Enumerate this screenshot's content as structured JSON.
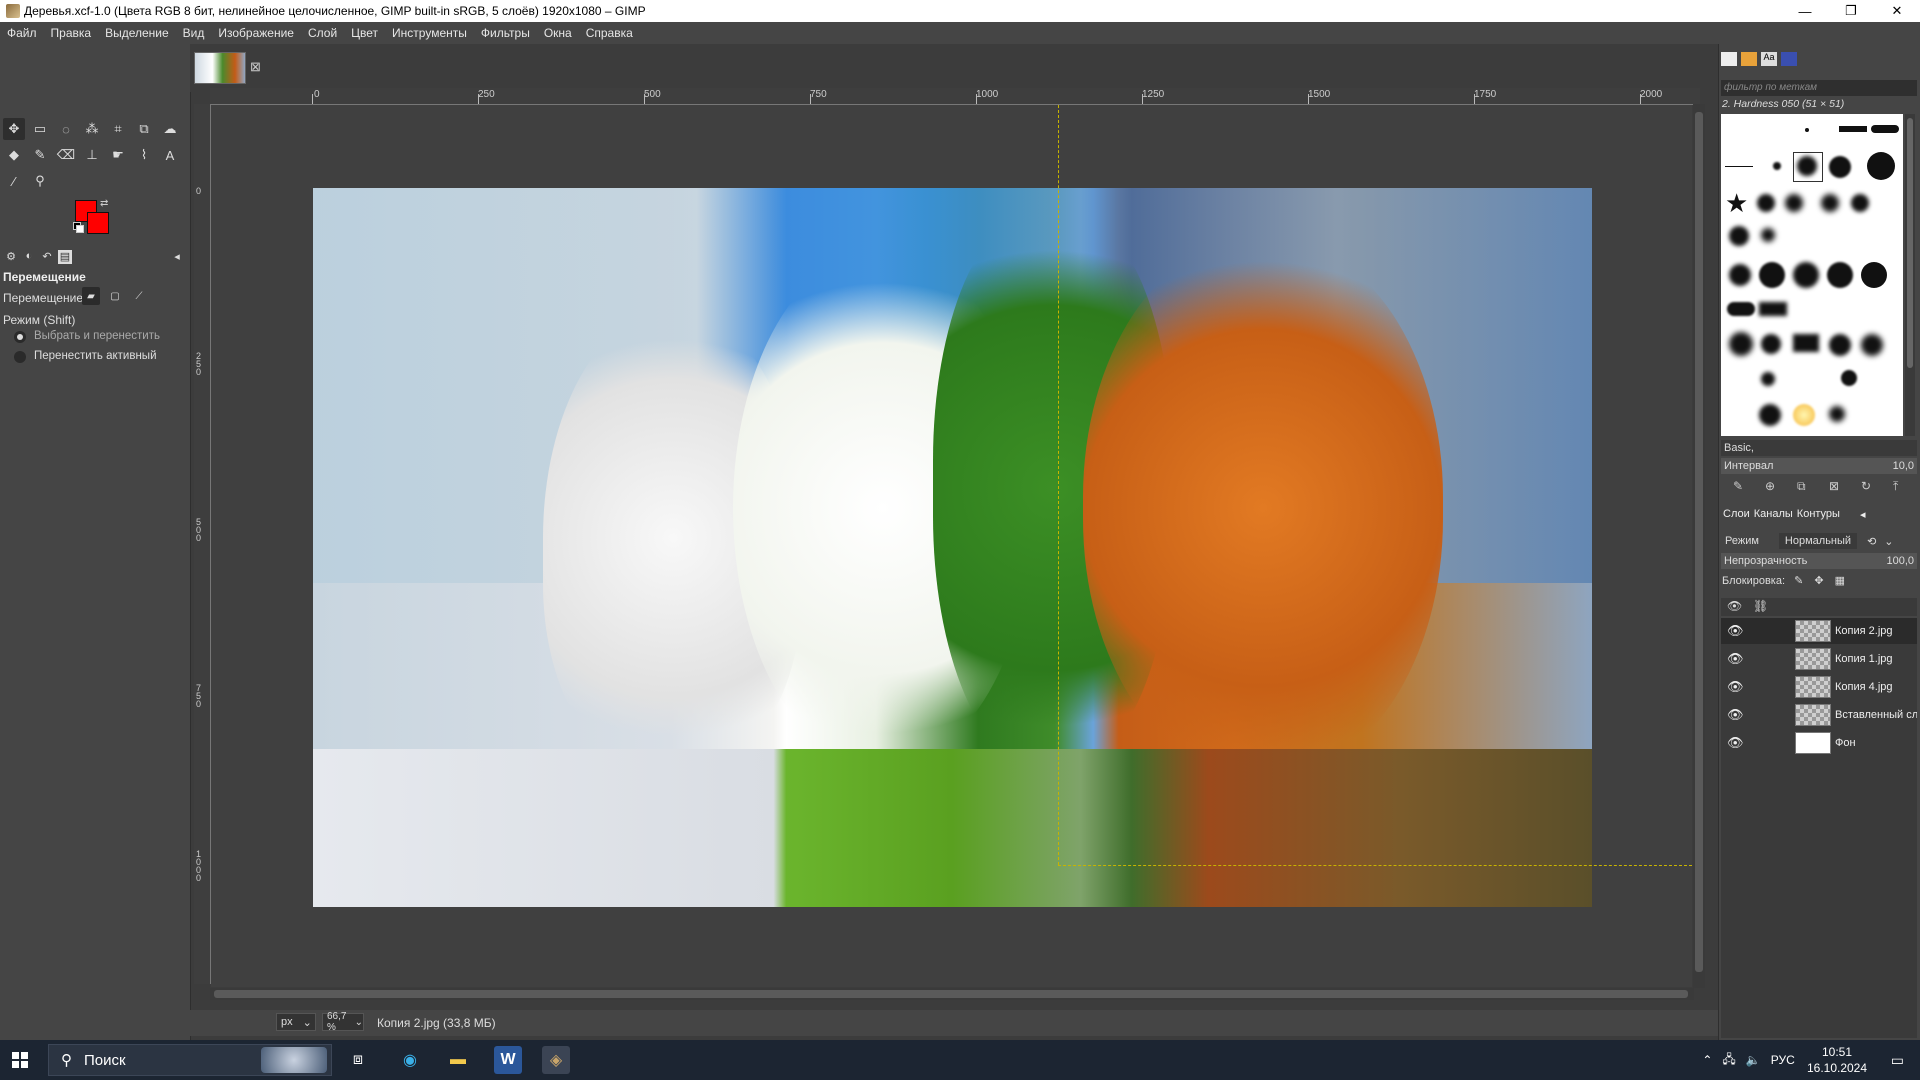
{
  "window": {
    "title": "Деревья.xcf-1.0 (Цвета RGB 8 бит, нелинейное целочисленное, GIMP built-in sRGB, 5 слоёв) 1920x1080 – GIMP",
    "minimize": "—",
    "maximize": "❐",
    "close": "✕"
  },
  "menu": [
    "Файл",
    "Правка",
    "Выделение",
    "Вид",
    "Изображение",
    "Слой",
    "Цвет",
    "Инструменты",
    "Фильтры",
    "Окна",
    "Справка"
  ],
  "tools": [
    "move-icon",
    "rect-select-icon",
    "lasso-icon",
    "fuzzy-select-icon",
    "crop-icon",
    "unified-transform-icon",
    "warp-icon",
    "bucket-fill-icon",
    "paintbrush-icon",
    "eraser-icon",
    "clone-icon",
    "smudge-icon",
    "path-icon",
    "text-icon",
    "color-picker-icon",
    "zoom-icon"
  ],
  "colors": {
    "foreground": "#ff0000",
    "background": "#ff0000",
    "accent": "#c8b400"
  },
  "tool_options": {
    "title": "Перемещение",
    "move_label": "Перемещение:",
    "mode_label": "Режим (Shift)",
    "radio1": "Выбрать и перенестить",
    "radio2": "Перенестить активный"
  },
  "ruler": {
    "top": [
      "0",
      "250",
      "500",
      "750",
      "1000",
      "1250",
      "1500",
      "1750",
      "2000"
    ],
    "left": [
      "0",
      "250",
      "500",
      "750",
      "1000"
    ]
  },
  "status": {
    "unit": "px",
    "zoom": "66,7 %",
    "text": "Копия 2.jpg (33,8 МБ)"
  },
  "brushes": {
    "filter_placeholder": "фильтр по меткам",
    "current": "2. Hardness 050 (51 × 51)",
    "preset": "Basic,",
    "interval_label": "Интервал",
    "interval_value": "10,0"
  },
  "layers_panel": {
    "tab_layers": "Слои",
    "tab_channels": "Каналы",
    "tab_paths": "Контуры",
    "mode_label": "Режим",
    "mode_value": "Нормальный",
    "opacity_label": "Непрозрачность",
    "opacity_value": "100,0",
    "lock_label": "Блокировка:",
    "layers": [
      {
        "name": "Копия 2.jpg",
        "active": true
      },
      {
        "name": "Копия 1.jpg",
        "active": false
      },
      {
        "name": "Копия 4.jpg",
        "active": false
      },
      {
        "name": "Вставленный слой",
        "active": false
      },
      {
        "name": "Фон",
        "active": false
      }
    ]
  },
  "taskbar": {
    "search": "Поиск",
    "lang": "РУС",
    "time": "10:51",
    "date": "16.10.2024"
  }
}
